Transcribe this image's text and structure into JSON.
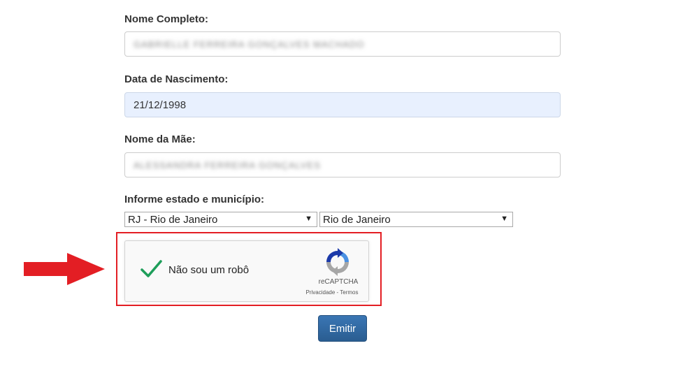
{
  "form": {
    "full_name": {
      "label": "Nome Completo:",
      "value": "GABRIELLE FERREIRA GONÇALVES MACHADO"
    },
    "birth_date": {
      "label": "Data de Nascimento:",
      "value": "21/12/1998"
    },
    "mother_name": {
      "label": "Nome da Mãe:",
      "value": "ALESSANDRA FERREIRA GONÇALVES"
    },
    "location": {
      "label": "Informe estado e município:",
      "state_selected": "RJ - Rio de Janeiro",
      "city_selected": "Rio de Janeiro"
    },
    "captcha": {
      "label": "Não sou um robô",
      "brand": "reCAPTCHA",
      "links": "Privacidade - Termos",
      "checked": true,
      "logo_icon": "recaptcha-logo-icon"
    },
    "submit_label": "Emitir"
  },
  "annotation": {
    "arrow_icon": "red-arrow-icon",
    "highlight_color": "#e31e24"
  },
  "colors": {
    "button": "#2f6aa6",
    "autofill_bg": "#e8f0fe",
    "check_green": "#1e9e5a"
  }
}
